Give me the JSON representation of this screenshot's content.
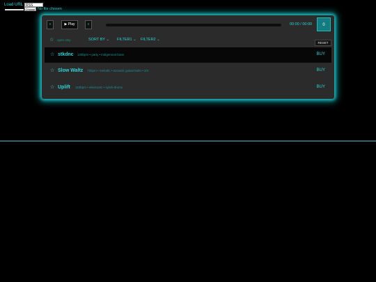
{
  "load_url": {
    "label": "Load URL",
    "input_value": "RSS LINKS",
    "file_button": "Choose",
    "no_file": "No file chosen"
  },
  "player": {
    "prev_label": "«",
    "play_label": "▶ Play",
    "next_label": "»",
    "time": "00:00 / 00:00",
    "counter": "0"
  },
  "filters": {
    "star": "☆",
    "open_only": "open only",
    "sort_by": "SORT BY",
    "filter1": "FILTER1",
    "filter2": "FILTER2",
    "reset": "RESET"
  },
  "tracks": [
    {
      "star": "☆",
      "title": "stkdnc",
      "meta": "128bpm • party • indigenous:bass",
      "buy": "BUY"
    },
    {
      "star": "☆",
      "title": "Slow Waltz",
      "meta": "72bpm • melodic • acoustic guitar/violin • 3/4",
      "buy": "BUY"
    },
    {
      "star": "☆",
      "title": "Uplift",
      "meta": "110bpm • electronic • synth-drums",
      "buy": "BUY"
    }
  ],
  "colors": {
    "accent": "#2fd3d7",
    "panel": "#2b2b2b",
    "glow": "#1fb8bc"
  }
}
